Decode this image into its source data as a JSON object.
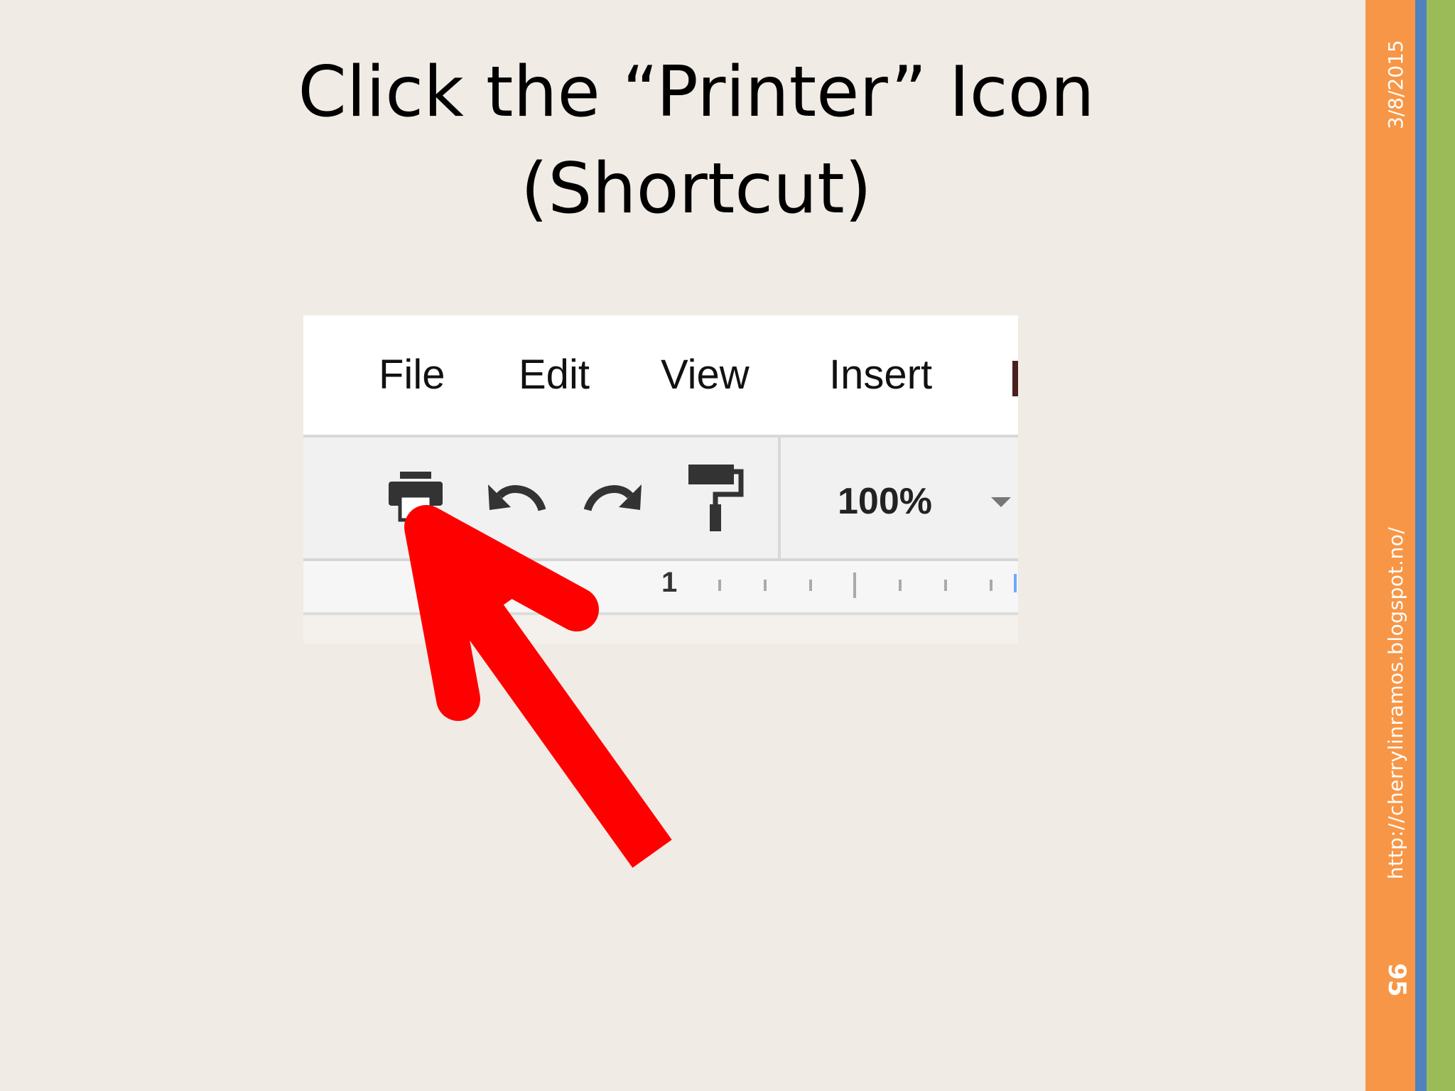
{
  "slide": {
    "title_line1": "Click the “Printer” Icon",
    "title_line2": "(Shortcut)",
    "date": "3/8/2015",
    "url": "http://cherrylinramos.blogspot.no/",
    "page_number": "95"
  },
  "screenshot": {
    "menu": [
      "File",
      "Edit",
      "View",
      "Insert"
    ],
    "zoom_label": "100%",
    "ruler_label": "1",
    "icons": [
      "printer-icon",
      "undo-icon",
      "redo-icon",
      "paint-format-icon",
      "dropdown-arrow-icon"
    ]
  },
  "colors": {
    "background": "#f0ebe4",
    "bar_orange": "#f79646",
    "bar_blue": "#4f81bd",
    "bar_green": "#9bbb59",
    "arrow": "#ff0000"
  }
}
